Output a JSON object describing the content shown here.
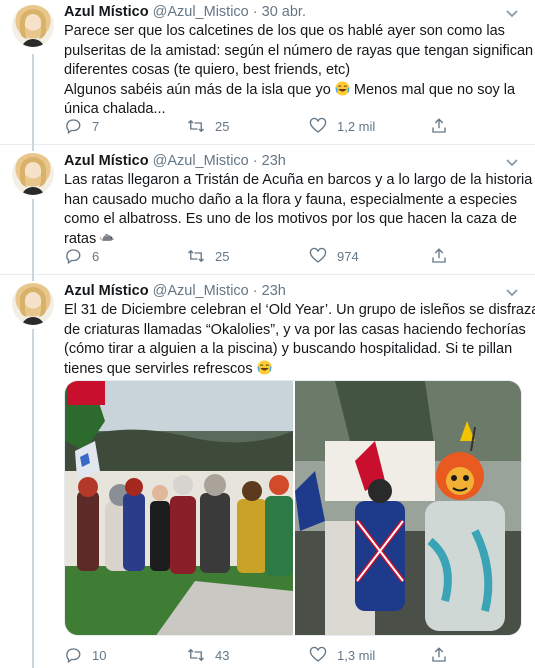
{
  "tweets": [
    {
      "name": "Azul Místico",
      "handle": "@Azul_Mistico",
      "dot": "·",
      "time": "30 abr.",
      "lines": [
        "Parece ser que los calcetines de los que os hablé ayer son como las",
        "pulseritas de la amistad: según el número de rayas que tengan significan",
        "diferentes cosas (te quiero, best friends, etc)",
        "Algunos sabéis aún más de la isla que yo",
        " Menos mal que no soy la",
        "única chalada..."
      ],
      "replies": "7",
      "retweets": "25",
      "likes": "1,2 mil"
    },
    {
      "name": "Azul Místico",
      "handle": "@Azul_Mistico",
      "dot": "·",
      "time": "23h",
      "lines": [
        "Las ratas llegaron a Tristán de Acuña en barcos y a lo largo de la historia",
        "han causado mucho daño a la flora y fauna, especialmente a especies",
        "como el albatross. Es uno de los motivos por los que hacen la caza de",
        "ratas"
      ],
      "replies": "6",
      "retweets": "25",
      "likes": "974"
    },
    {
      "name": "Azul Místico",
      "handle": "@Azul_Mistico",
      "dot": "·",
      "time": "23h",
      "lines": [
        "El 31 de Diciembre celebran el ‘Old Year’. Un grupo de isleños se disfraza",
        "de criaturas llamadas “Okalolies”, y va por las casas haciendo fechorías",
        "(cómo tirar a alguien a la piscina) y buscando hospitalidad. Si te pillan",
        "tienes que servirles refrescos"
      ],
      "replies": "10",
      "retweets": "43",
      "likes": "1,3 mil"
    }
  ],
  "icons": {
    "reply": "reply-icon",
    "retweet": "retweet-icon",
    "like": "heart-icon",
    "share": "share-icon",
    "chevron": "chevron-down-icon",
    "laugh": "laughing-emoji-icon",
    "rat": "rat-emoji-icon"
  },
  "colors": {
    "text": "#14171a",
    "secondary": "#657786",
    "divider": "#e6ecf0",
    "thread": "#ccd6dd"
  }
}
